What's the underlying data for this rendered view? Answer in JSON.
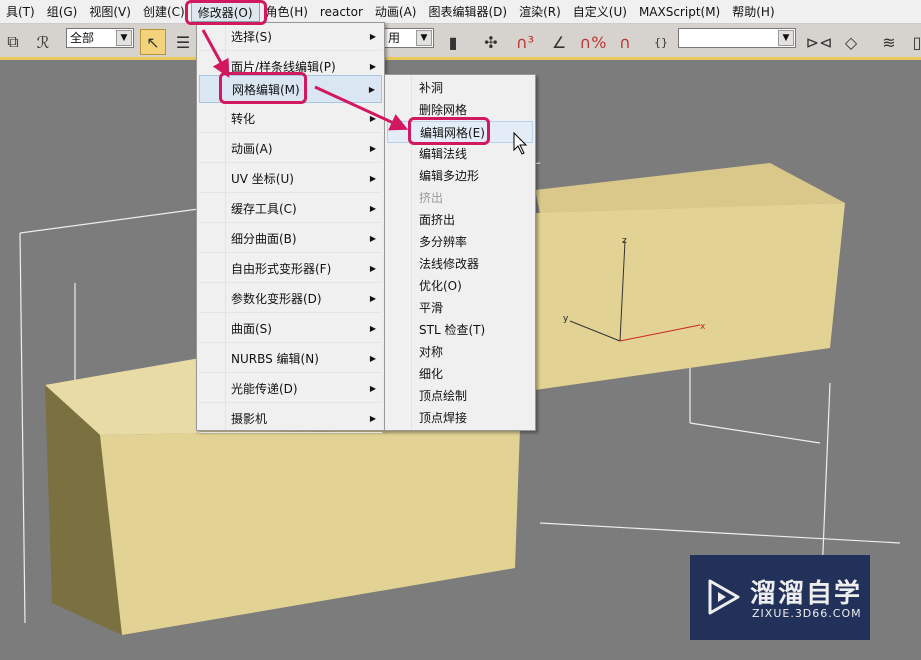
{
  "menubar": {
    "items": [
      "具(T)",
      "组(G)",
      "视图(V)",
      "创建(C)",
      "修改器(O)",
      "角色(H)",
      "reactor",
      "动画(A)",
      "图表编辑器(D)",
      "渲染(R)",
      "自定义(U)",
      "MAXScript(M)",
      "帮助(H)"
    ],
    "active_index": 4
  },
  "toolbar": {
    "selection_filter": "全部",
    "view_dropdown": "",
    "named_selection": "",
    "ref_coord_partial": "用"
  },
  "main_menu": {
    "items": [
      {
        "label": "选择(S)",
        "submenu": true
      },
      {
        "label": "面片/样条线编辑(P)",
        "submenu": true
      },
      {
        "label": "网格编辑(M)",
        "submenu": true
      },
      {
        "label": "转化",
        "submenu": true
      },
      {
        "label": "动画(A)",
        "submenu": true
      },
      {
        "label": "UV 坐标(U)",
        "submenu": true
      },
      {
        "label": "缓存工具(C)",
        "submenu": true
      },
      {
        "label": "细分曲面(B)",
        "submenu": true
      },
      {
        "label": "自由形式变形器(F)",
        "submenu": true
      },
      {
        "label": "参数化变形器(D)",
        "submenu": true
      },
      {
        "label": "曲面(S)",
        "submenu": true
      },
      {
        "label": "NURBS 编辑(N)",
        "submenu": true
      },
      {
        "label": "光能传递(D)",
        "submenu": true
      },
      {
        "label": "摄影机",
        "submenu": true
      }
    ],
    "highlighted_index": 2
  },
  "sub_menu": {
    "items": [
      {
        "label": "补洞"
      },
      {
        "label": "删除网格"
      },
      {
        "label": "编辑网格(E)"
      },
      {
        "label": "编辑法线"
      },
      {
        "label": "编辑多边形"
      },
      {
        "label": "挤出",
        "disabled": true
      },
      {
        "label": "面挤出"
      },
      {
        "label": "多分辨率"
      },
      {
        "label": "法线修改器"
      },
      {
        "label": "优化(O)"
      },
      {
        "label": "平滑"
      },
      {
        "label": "STL 检查(T)"
      },
      {
        "label": "对称"
      },
      {
        "label": "细化"
      },
      {
        "label": "顶点绘制"
      },
      {
        "label": "顶点焊接"
      }
    ],
    "highlighted_index": 2
  },
  "gizmo": {
    "x": "x",
    "y": "y",
    "z": "z"
  },
  "watermark": {
    "title": "溜溜自学",
    "url": "ZIXUE.3D66.COM"
  },
  "colors": {
    "annotation": "#d2185f",
    "box": "#e2d394",
    "viewport": "#7c7c7c",
    "watermark_bg": "#22315a"
  }
}
